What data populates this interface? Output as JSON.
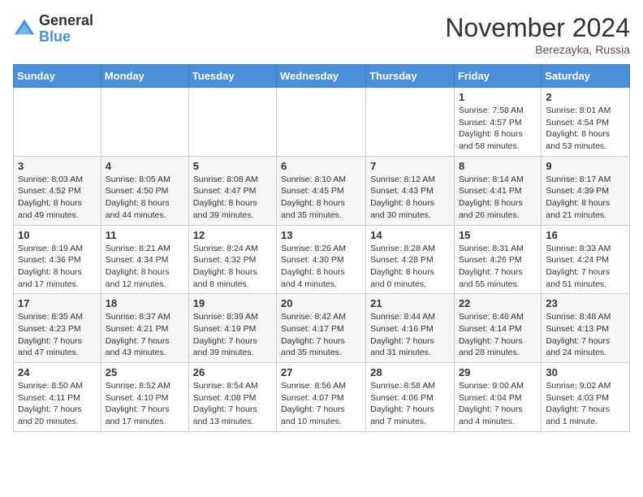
{
  "logo": {
    "general": "General",
    "blue": "Blue"
  },
  "title": {
    "month": "November 2024",
    "location": "Berezayka, Russia"
  },
  "weekdays": [
    "Sunday",
    "Monday",
    "Tuesday",
    "Wednesday",
    "Thursday",
    "Friday",
    "Saturday"
  ],
  "weeks": [
    [
      {
        "day": "",
        "info": ""
      },
      {
        "day": "",
        "info": ""
      },
      {
        "day": "",
        "info": ""
      },
      {
        "day": "",
        "info": ""
      },
      {
        "day": "",
        "info": ""
      },
      {
        "day": "1",
        "info": "Sunrise: 7:58 AM\nSunset: 4:57 PM\nDaylight: 8 hours\nand 58 minutes."
      },
      {
        "day": "2",
        "info": "Sunrise: 8:01 AM\nSunset: 4:54 PM\nDaylight: 8 hours\nand 53 minutes."
      }
    ],
    [
      {
        "day": "3",
        "info": "Sunrise: 8:03 AM\nSunset: 4:52 PM\nDaylight: 8 hours\nand 49 minutes."
      },
      {
        "day": "4",
        "info": "Sunrise: 8:05 AM\nSunset: 4:50 PM\nDaylight: 8 hours\nand 44 minutes."
      },
      {
        "day": "5",
        "info": "Sunrise: 8:08 AM\nSunset: 4:47 PM\nDaylight: 8 hours\nand 39 minutes."
      },
      {
        "day": "6",
        "info": "Sunrise: 8:10 AM\nSunset: 4:45 PM\nDaylight: 8 hours\nand 35 minutes."
      },
      {
        "day": "7",
        "info": "Sunrise: 8:12 AM\nSunset: 4:43 PM\nDaylight: 8 hours\nand 30 minutes."
      },
      {
        "day": "8",
        "info": "Sunrise: 8:14 AM\nSunset: 4:41 PM\nDaylight: 8 hours\nand 26 minutes."
      },
      {
        "day": "9",
        "info": "Sunrise: 8:17 AM\nSunset: 4:39 PM\nDaylight: 8 hours\nand 21 minutes."
      }
    ],
    [
      {
        "day": "10",
        "info": "Sunrise: 8:19 AM\nSunset: 4:36 PM\nDaylight: 8 hours\nand 17 minutes."
      },
      {
        "day": "11",
        "info": "Sunrise: 8:21 AM\nSunset: 4:34 PM\nDaylight: 8 hours\nand 12 minutes."
      },
      {
        "day": "12",
        "info": "Sunrise: 8:24 AM\nSunset: 4:32 PM\nDaylight: 8 hours\nand 8 minutes."
      },
      {
        "day": "13",
        "info": "Sunrise: 8:26 AM\nSunset: 4:30 PM\nDaylight: 8 hours\nand 4 minutes."
      },
      {
        "day": "14",
        "info": "Sunrise: 8:28 AM\nSunset: 4:28 PM\nDaylight: 8 hours\nand 0 minutes."
      },
      {
        "day": "15",
        "info": "Sunrise: 8:31 AM\nSunset: 4:26 PM\nDaylight: 7 hours\nand 55 minutes."
      },
      {
        "day": "16",
        "info": "Sunrise: 8:33 AM\nSunset: 4:24 PM\nDaylight: 7 hours\nand 51 minutes."
      }
    ],
    [
      {
        "day": "17",
        "info": "Sunrise: 8:35 AM\nSunset: 4:23 PM\nDaylight: 7 hours\nand 47 minutes."
      },
      {
        "day": "18",
        "info": "Sunrise: 8:37 AM\nSunset: 4:21 PM\nDaylight: 7 hours\nand 43 minutes."
      },
      {
        "day": "19",
        "info": "Sunrise: 8:39 AM\nSunset: 4:19 PM\nDaylight: 7 hours\nand 39 minutes."
      },
      {
        "day": "20",
        "info": "Sunrise: 8:42 AM\nSunset: 4:17 PM\nDaylight: 7 hours\nand 35 minutes."
      },
      {
        "day": "21",
        "info": "Sunrise: 8:44 AM\nSunset: 4:16 PM\nDaylight: 7 hours\nand 31 minutes."
      },
      {
        "day": "22",
        "info": "Sunrise: 8:46 AM\nSunset: 4:14 PM\nDaylight: 7 hours\nand 28 minutes."
      },
      {
        "day": "23",
        "info": "Sunrise: 8:48 AM\nSunset: 4:13 PM\nDaylight: 7 hours\nand 24 minutes."
      }
    ],
    [
      {
        "day": "24",
        "info": "Sunrise: 8:50 AM\nSunset: 4:11 PM\nDaylight: 7 hours\nand 20 minutes."
      },
      {
        "day": "25",
        "info": "Sunrise: 8:52 AM\nSunset: 4:10 PM\nDaylight: 7 hours\nand 17 minutes."
      },
      {
        "day": "26",
        "info": "Sunrise: 8:54 AM\nSunset: 4:08 PM\nDaylight: 7 hours\nand 13 minutes."
      },
      {
        "day": "27",
        "info": "Sunrise: 8:56 AM\nSunset: 4:07 PM\nDaylight: 7 hours\nand 10 minutes."
      },
      {
        "day": "28",
        "info": "Sunrise: 8:58 AM\nSunset: 4:06 PM\nDaylight: 7 hours\nand 7 minutes."
      },
      {
        "day": "29",
        "info": "Sunrise: 9:00 AM\nSunset: 4:04 PM\nDaylight: 7 hours\nand 4 minutes."
      },
      {
        "day": "30",
        "info": "Sunrise: 9:02 AM\nSunset: 4:03 PM\nDaylight: 7 hours\nand 1 minute."
      }
    ]
  ]
}
